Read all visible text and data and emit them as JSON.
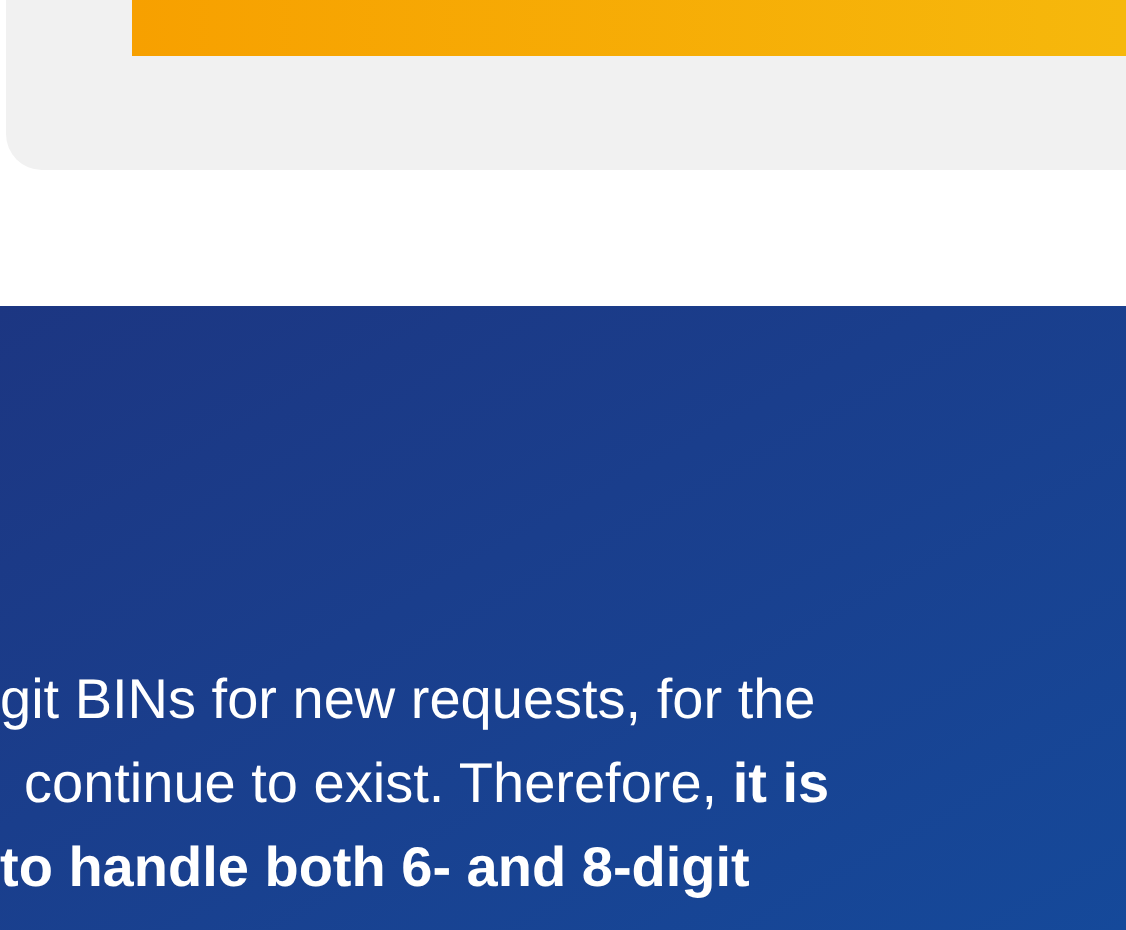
{
  "banner": {
    "lines": [
      "git BINs for new requests, for the",
      "continue to exist. Therefore, **it is**",
      "**to handle both 6- and 8-digit**"
    ]
  }
}
